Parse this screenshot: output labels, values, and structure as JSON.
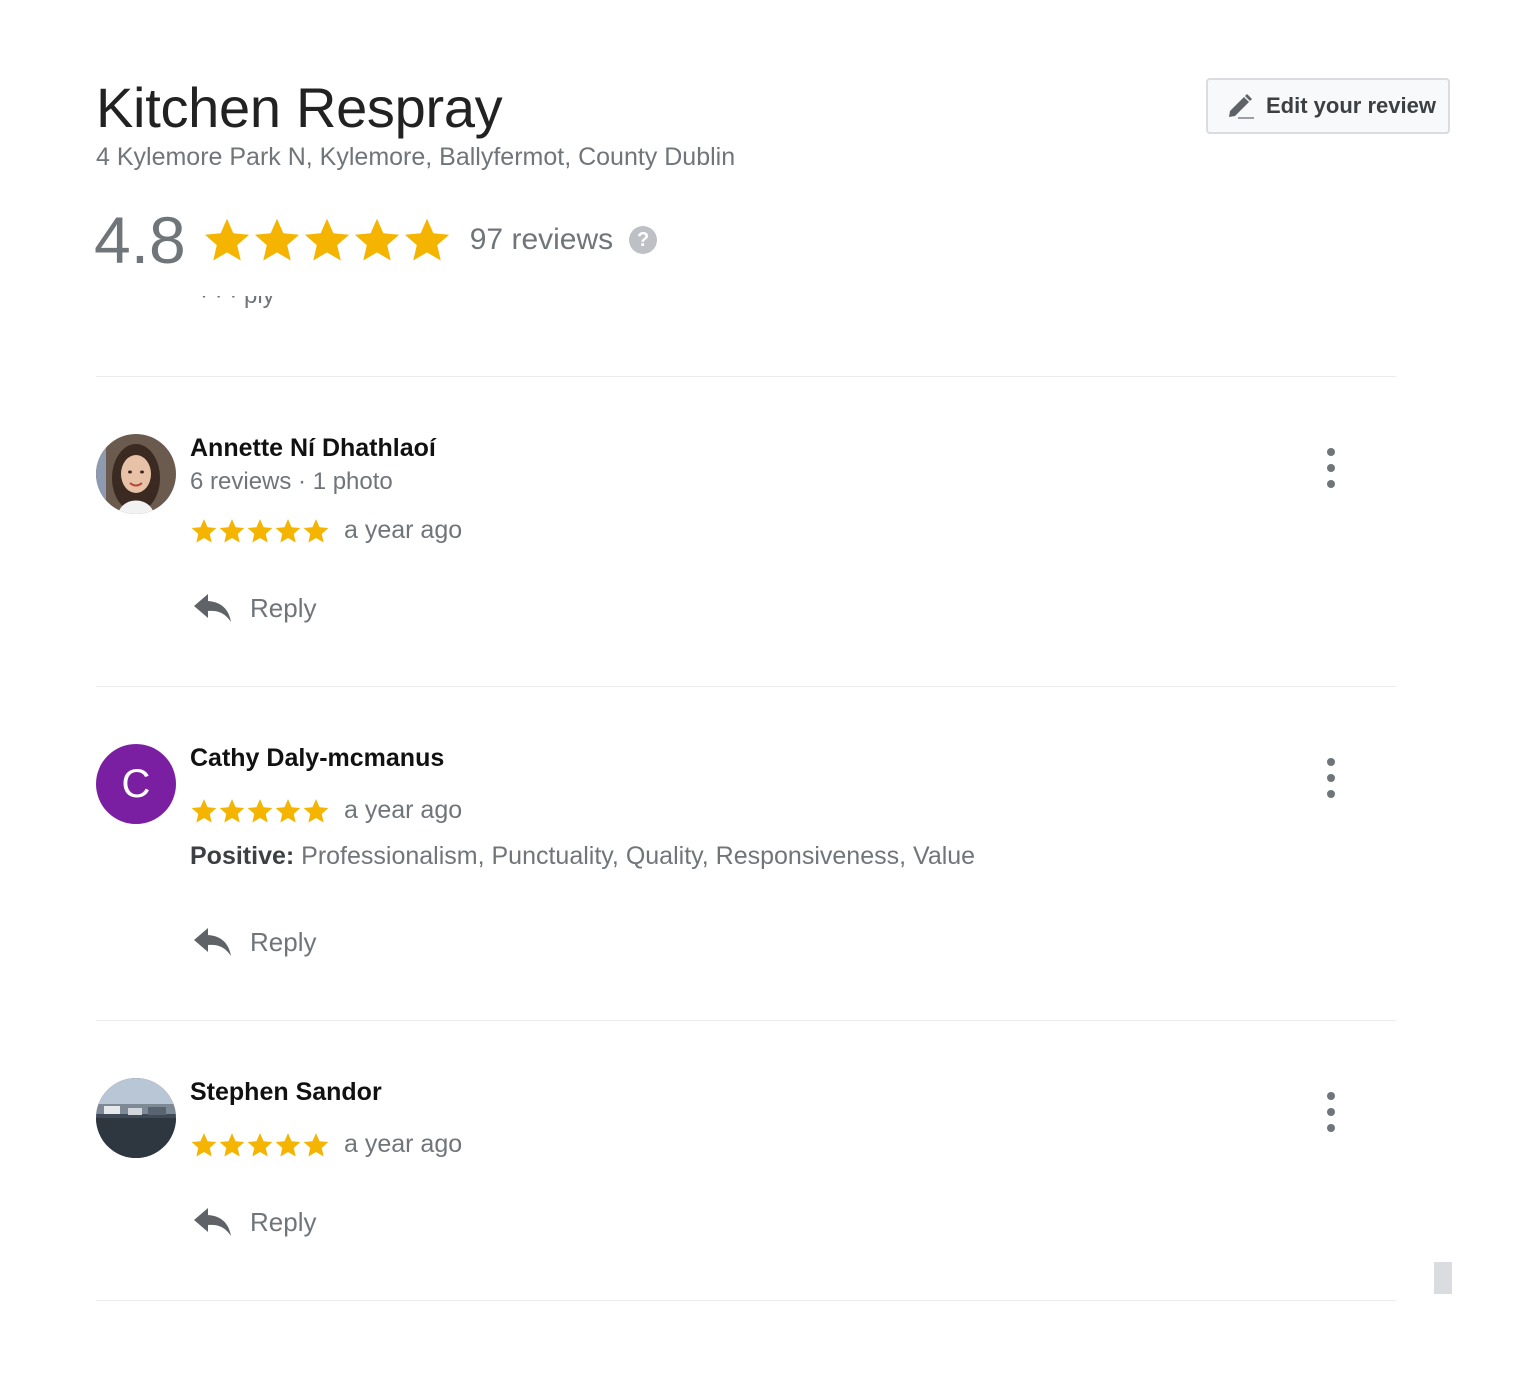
{
  "business": {
    "name": "Kitchen Respray",
    "address": "4 Kylemore Park N, Kylemore, Ballyfermot, County Dublin",
    "rating": "4.8",
    "rating_stars": 5,
    "review_count": "97 reviews",
    "help_glyph": "?"
  },
  "toolbar": {
    "edit_review_label": "Edit your review",
    "edit_icon": "pencil-icon"
  },
  "colors": {
    "star": "#f4b400",
    "avatar_purple": "#7b1fa2",
    "muted_text": "#70757a"
  },
  "previous_review_fragment": "· · · ply",
  "reviews": [
    {
      "name": "Annette Ní Dhathlaoí",
      "meta": "6 reviews · 1 photo",
      "stars": 5,
      "time": "a year ago",
      "reply_label": "Reply",
      "avatar": "photo"
    },
    {
      "name": "Cathy Daly-mcmanus",
      "avatar_letter": "C",
      "stars": 5,
      "time": "a year ago",
      "positive_label": "Positive:",
      "positive_text": "Professionalism, Punctuality, Quality, Responsiveness, Value",
      "reply_label": "Reply",
      "avatar": "letter"
    },
    {
      "name": "Stephen Sandor",
      "stars": 5,
      "time": "a year ago",
      "reply_label": "Reply",
      "avatar": "photo"
    }
  ]
}
